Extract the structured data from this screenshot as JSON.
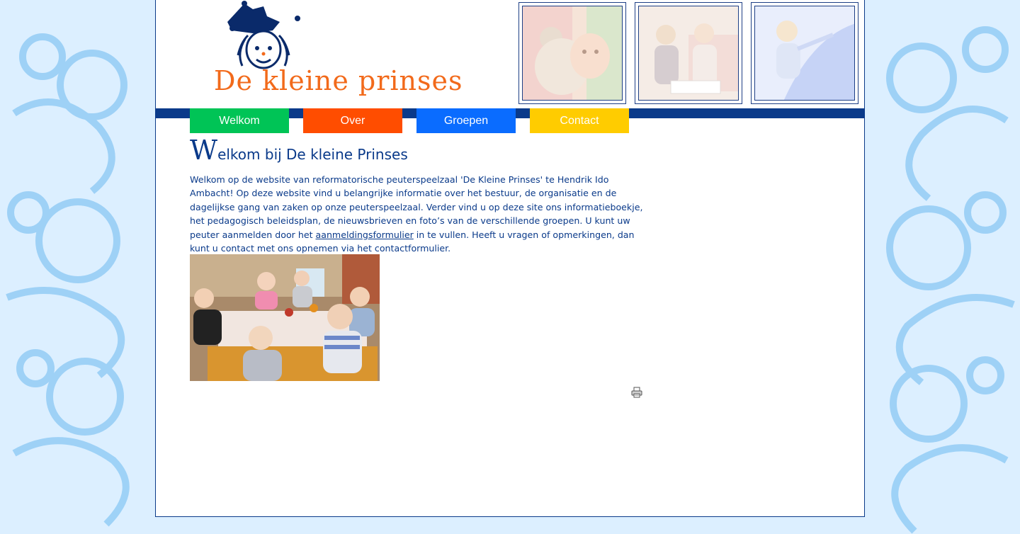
{
  "logo": {
    "text": "De kleine prinses"
  },
  "nav": [
    {
      "label": "Welkom",
      "color": "#00c456"
    },
    {
      "label": "Over",
      "color": "#ff4d00"
    },
    {
      "label": "Groepen",
      "color": "#0a6cff"
    },
    {
      "label": "Contact",
      "color": "#ffcc00"
    }
  ],
  "content": {
    "heading_first": "W",
    "heading_rest": "elkom bij De kleine Prinses",
    "intro_before_link": "Welkom op de website van reformatorische peuterspeelzaal 'De Kleine Prinses' te Hendrik Ido Ambacht! Op deze website vind u belangrijke informatie over het bestuur, de organisatie en de dagelijkse gang van zaken op onze peuterspeelzaal. Verder vind u op deze site ons informatieboekje, het pedagogisch beleidsplan, de nieuwsbrieven en foto’s  van de verschillende groepen. U kunt uw peuter aanmelden door het ",
    "link_text": "aanmeldingsformulier",
    "intro_after_link": " in te vullen. Heeft u vragen of opmerkingen, dan kunt u contact met ons opnemen via het contactformulier."
  },
  "colors": {
    "brand_blue": "#0a3a8a",
    "logo_orange": "#f26a1b",
    "page_bg": "#dcefff"
  },
  "icons": {
    "print": "printer-icon"
  }
}
